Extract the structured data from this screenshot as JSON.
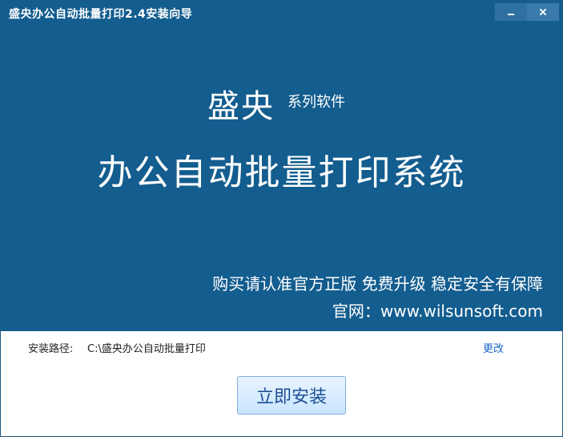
{
  "window": {
    "title": "盛央办公自动批量打印2.4安装向导",
    "minimize_icon": "minimize-icon",
    "close_icon": "close-icon"
  },
  "banner": {
    "brand": "盛央",
    "series": "系列软件",
    "product": "办公自动批量打印系统",
    "slogan": "购买请认准官方正版 免费升级 稳定安全有保障",
    "website": "官网：www.wilsunsoft.com",
    "background_color": "#135d8f"
  },
  "install": {
    "path_label": "安装路径:",
    "path_value": "C:\\盛央办公自动批量打印",
    "change_label": "更改",
    "install_button": "立即安装"
  }
}
